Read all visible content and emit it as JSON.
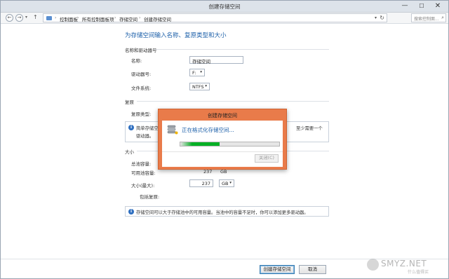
{
  "window": {
    "title": "创建存储空间",
    "controls": {
      "minimize": "—",
      "maximize": "☐",
      "close": "✕"
    }
  },
  "address_bar": {
    "breadcrumbs": [
      "控制面板",
      "所有控制面板项",
      "存储空间",
      "创建存储空间"
    ],
    "separator": "›",
    "search_placeholder": "搜索控制面..."
  },
  "page": {
    "heading": "为存储空间输入名称、复原类型和大小",
    "name_section": {
      "title": "名称和驱动器号",
      "name_label": "名称:",
      "name_value": "存储空间",
      "drive_label": "驱动器号:",
      "drive_value": "F:",
      "fs_label": "文件系统:",
      "fs_value": "NTFS"
    },
    "resiliency_section": {
      "title": "复原",
      "type_label": "复原类型:",
      "info_line1_left": "简单存储空间",
      "info_line1_right": "至少需要一个",
      "info_line2": "驱动器。"
    },
    "size_section": {
      "title": "大小",
      "total_label": "总池容量:",
      "available_label": "可用池容量:",
      "available_value": "237",
      "available_unit": "GB",
      "max_label": "大小(最大):",
      "max_value": "237",
      "max_unit": "GB",
      "resiliency_incl_label": "包括复原:",
      "info_text": "存储空间可以大于存储池中的可用容量。当池中的容量不足时，你可以添加更多驱动器。"
    }
  },
  "footer": {
    "create_label": "创建存储空间",
    "cancel_label": "取消"
  },
  "dialog": {
    "title": "创建存储空间",
    "message": "正在格式化存储空间...",
    "close_label": "关闭(C)",
    "progress_state": "indeterminate",
    "accent_color": "#e97b4a",
    "progress_color": "#06b025"
  },
  "watermark": {
    "text": "SMYZ.NET",
    "sub": "什么值得买"
  }
}
